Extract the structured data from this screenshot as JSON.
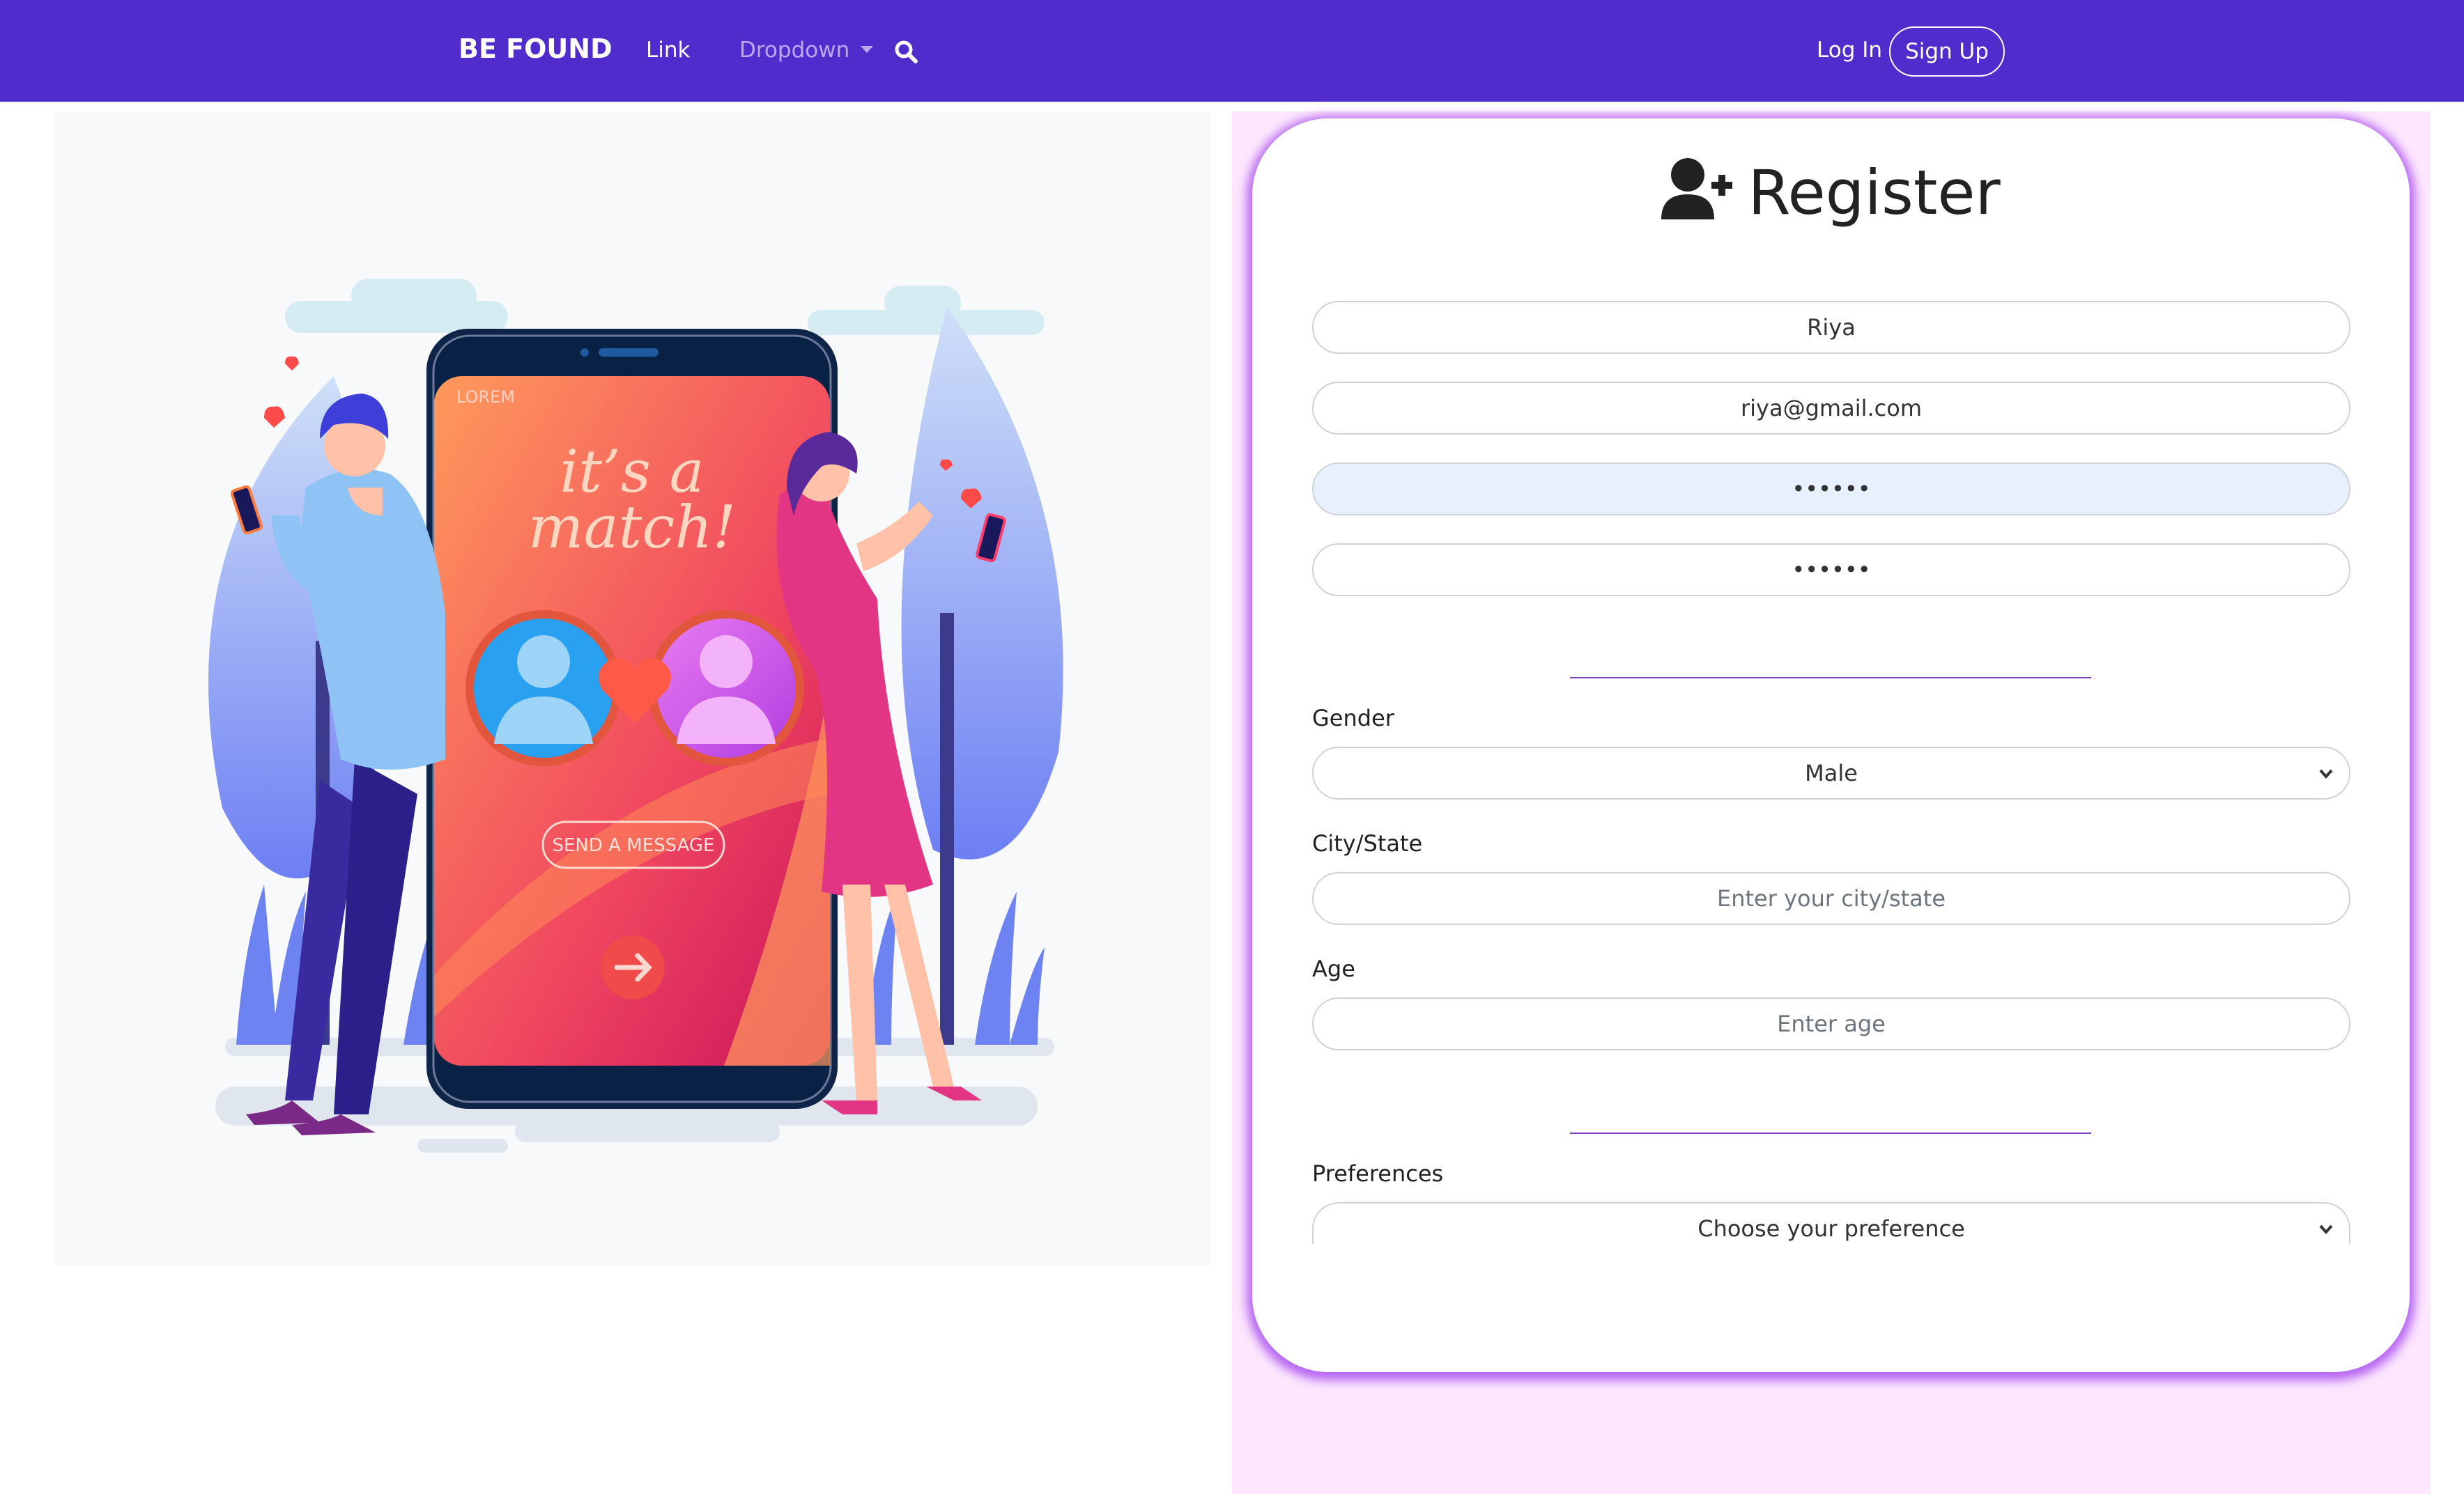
{
  "navbar": {
    "brand": "BE FOUND",
    "link": "Link",
    "dropdown": "Dropdown",
    "login": "Log In",
    "signup": "Sign Up",
    "bg_color": "#4f2ccb"
  },
  "illustration": {
    "status_text": "LOREM",
    "headline_line1": "it’s a",
    "headline_line2": "match!",
    "button_text": "SEND A MESSAGE"
  },
  "register": {
    "title": "Register",
    "name_value": "Riya",
    "email_value": "riya@gmail.com",
    "password_value": "••••••",
    "confirm_password_value": "••••••",
    "gender_label": "Gender",
    "gender_value": "Male",
    "city_label": "City/State",
    "city_placeholder": "Enter your city/state",
    "age_label": "Age",
    "age_placeholder": "Enter age",
    "preferences_label": "Preferences",
    "preferences_value": "Choose your preference"
  },
  "colors": {
    "accent": "#4f2ccb",
    "card_glow": "#aa50f0",
    "panel_bg": "#fde6fe"
  }
}
